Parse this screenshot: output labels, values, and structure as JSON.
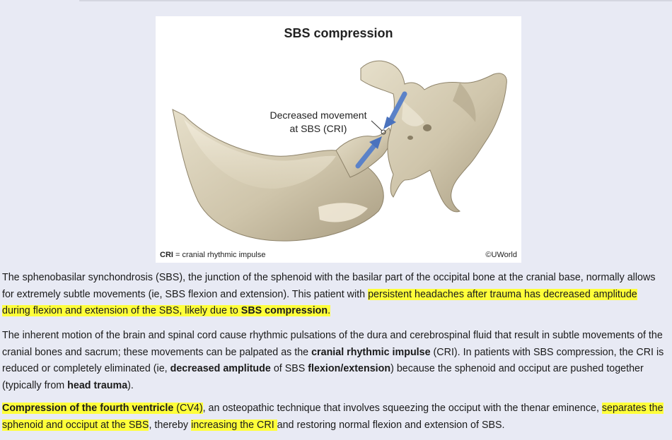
{
  "figure": {
    "title": "SBS compression",
    "callout_line1": "Decreased movement",
    "callout_line2": "at SBS (CRI)",
    "caption_abbr": "CRI",
    "caption_rest": " = cranial rhythmic impulse",
    "credit": "©UWorld"
  },
  "paragraphs": {
    "p1": {
      "s1": "The sphenobasilar synchondrosis (SBS), the junction of the sphenoid with the basilar part of the occipital bone at the cranial base, normally allows for extremely subtle movements (ie, SBS flexion and extension).  This patient with ",
      "s2": "persistent headaches after trauma has decreased amplitude during flexion and extension of the SBS, likely due to ",
      "s3": "SBS compression",
      "s4": "."
    },
    "p2": {
      "s1": "The inherent motion of the brain and spinal cord cause rhythmic pulsations of the dura and cerebrospinal fluid that result in subtle movements of the cranial bones and sacrum; these movements can be palpated as the ",
      "s2": "cranial rhythmic impulse",
      "s3": " (CRI).  In patients with SBS compression, the CRI is reduced or completely eliminated (ie, ",
      "s4": "decreased amplitude",
      "s5": " of SBS ",
      "s6": "flexion/extension",
      "s7": ") because the sphenoid and occiput are pushed together (typically from ",
      "s8": "head trauma",
      "s9": ")."
    },
    "p3": {
      "s1": "Compression of the fourth ventricle",
      "s2": " (CV4)",
      "s3": ", an osteopathic technique that involves squeezing the occiput with the thenar eminence, ",
      "s4": "separates the sphenoid and occiput at the SBS",
      "s5": ", thereby ",
      "s6": "increasing the CRI ",
      "s7": "and restoring normal flexion and extension of SBS."
    }
  },
  "colors": {
    "highlight": "#ffff3a",
    "arrow": "#5b82c8",
    "bone": "#d6cdb5"
  }
}
